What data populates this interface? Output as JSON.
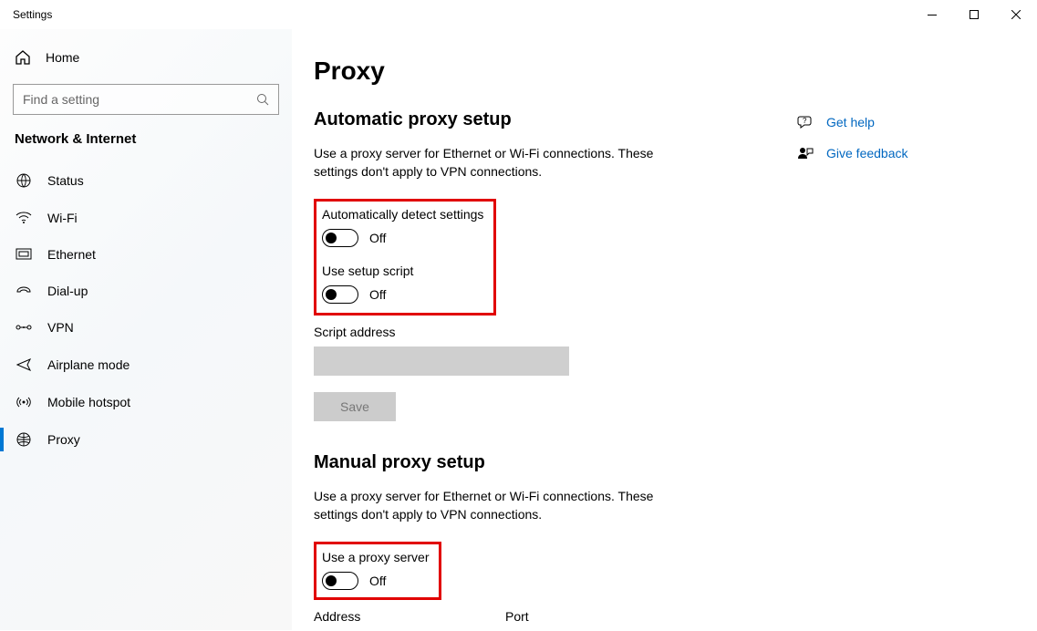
{
  "window": {
    "title": "Settings"
  },
  "sidebar": {
    "home": "Home",
    "search_placeholder": "Find a setting",
    "category": "Network & Internet",
    "items": [
      {
        "label": "Status"
      },
      {
        "label": "Wi-Fi"
      },
      {
        "label": "Ethernet"
      },
      {
        "label": "Dial-up"
      },
      {
        "label": "VPN"
      },
      {
        "label": "Airplane mode"
      },
      {
        "label": "Mobile hotspot"
      },
      {
        "label": "Proxy"
      }
    ]
  },
  "page": {
    "title": "Proxy",
    "auto": {
      "heading": "Automatic proxy setup",
      "desc": "Use a proxy server for Ethernet or Wi-Fi connections. These settings don't apply to VPN connections.",
      "detect_label": "Automatically detect settings",
      "detect_state": "Off",
      "script_label": "Use setup script",
      "script_state": "Off",
      "script_addr_label": "Script address",
      "script_addr_value": "",
      "save_label": "Save"
    },
    "manual": {
      "heading": "Manual proxy setup",
      "desc": "Use a proxy server for Ethernet or Wi-Fi connections. These settings don't apply to VPN connections.",
      "use_label": "Use a proxy server",
      "use_state": "Off",
      "address_label": "Address",
      "port_label": "Port"
    }
  },
  "aside": {
    "help": "Get help",
    "feedback": "Give feedback"
  }
}
